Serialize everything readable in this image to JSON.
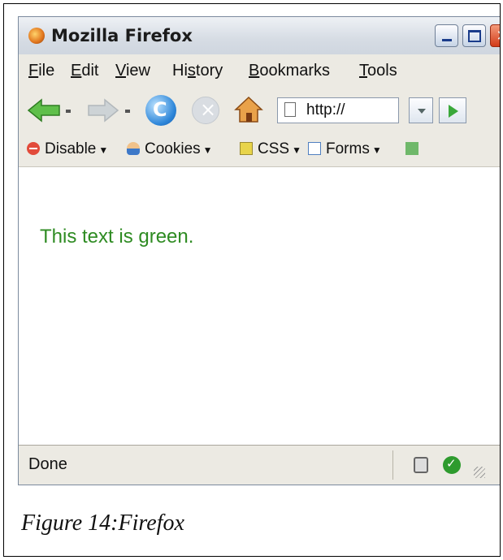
{
  "window": {
    "title": "Mozilla Firefox"
  },
  "menu": [
    {
      "underline": "F",
      "rest": "ile"
    },
    {
      "underline": "E",
      "rest": "dit"
    },
    {
      "underline": "V",
      "rest": "iew"
    },
    {
      "pre": "Hi",
      "underline": "s",
      "rest": "tory"
    },
    {
      "underline": "B",
      "rest": "ookmarks"
    },
    {
      "underline": "T",
      "rest": "ools"
    }
  ],
  "navigation": {
    "url": "http://"
  },
  "devbar": {
    "disable": "Disable",
    "cookies": "Cookies",
    "css": "CSS",
    "forms": "Forms"
  },
  "content": {
    "text": "This text is green.",
    "text_color": "#2e8b22"
  },
  "status": {
    "text": "Done"
  },
  "caption": "Figure 14:Firefox"
}
